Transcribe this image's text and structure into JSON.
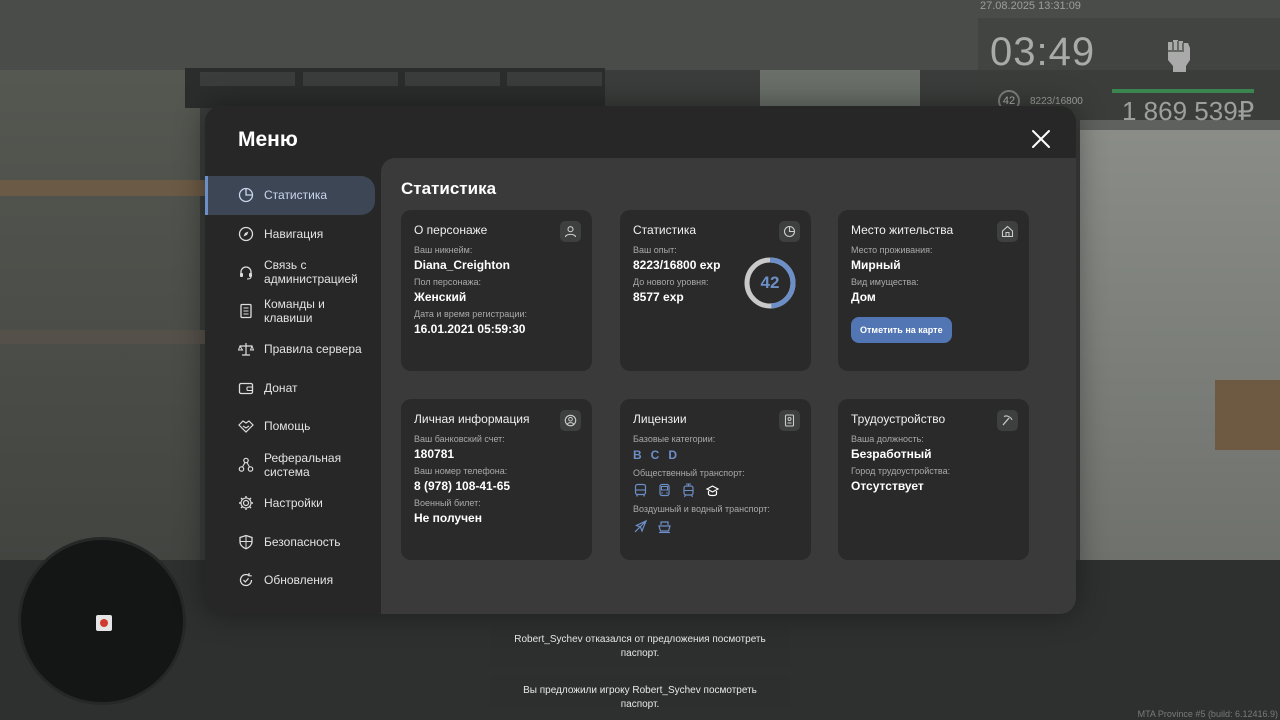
{
  "hud": {
    "datetime": "27.08.2025 13:31:09",
    "clock": "03:49",
    "level": "42",
    "exp": "8223/16800",
    "money": "1 869 539₽"
  },
  "notifications": [
    "Robert_Sychev отказался от предложения посмотреть паспорт.",
    "Вы предложили игроку Robert_Sychev посмотреть паспорт."
  ],
  "build_info": "MTA Province #5 (build: 6.12416.9)",
  "menu": {
    "title": "Меню",
    "sidebar": [
      {
        "label": "Статистика",
        "icon": "pie-chart-icon"
      },
      {
        "label": "Навигация",
        "icon": "compass-icon"
      },
      {
        "label": "Связь с администрацией",
        "icon": "headset-icon"
      },
      {
        "label": "Команды и клавиши",
        "icon": "document-icon"
      },
      {
        "label": "Правила сервера",
        "icon": "scales-icon"
      },
      {
        "label": "Донат",
        "icon": "wallet-icon"
      },
      {
        "label": "Помощь",
        "icon": "handshake-icon"
      },
      {
        "label": "Реферальная система",
        "icon": "network-icon"
      },
      {
        "label": "Настройки",
        "icon": "gear-icon"
      },
      {
        "label": "Безопасность",
        "icon": "shield-icon"
      },
      {
        "label": "Обновления",
        "icon": "refresh-check-icon"
      }
    ],
    "content_title": "Статистика",
    "cards": {
      "character": {
        "title": "О персонаже",
        "nickname_label": "Ваш никнейм:",
        "nickname": "Diana_Creighton",
        "gender_label": "Пол персонажа:",
        "gender": "Женский",
        "reg_label": "Дата и время регистрации:",
        "reg": "16.01.2021 05:59:30"
      },
      "stats": {
        "title": "Статистика",
        "exp_label": "Ваш опыт:",
        "exp": "8223/16800 exp",
        "next_label": "До нового уровня:",
        "next": "8577 exp",
        "level": "42",
        "level_progress": 0.49
      },
      "residence": {
        "title": "Место жительства",
        "place_label": "Место проживания:",
        "place": "Мирный",
        "type_label": "Вид имущества:",
        "type": "Дом",
        "button": "Отметить на карте"
      },
      "personal": {
        "title": "Личная информация",
        "bank_label": "Ваш банковский счет:",
        "bank": "180781",
        "phone_label": "Ваш номер телефона:",
        "phone": "8 (978) 108-41-65",
        "military_label": "Военный билет:",
        "military": "Не получен"
      },
      "licenses": {
        "title": "Лицензии",
        "base_label": "Базовые категории:",
        "categories": [
          "B",
          "C",
          "D"
        ],
        "public_label": "Общественный транспорт:",
        "public_icons": [
          "bus-icon",
          "bus-front-icon",
          "tram-icon",
          "taxi-icon"
        ],
        "air_label": "Воздушный и водный транспорт:",
        "air_icons": [
          "plane-icon",
          "boat-icon"
        ]
      },
      "job": {
        "title": "Трудоустройство",
        "position_label": "Ваша должность:",
        "position": "Безработный",
        "city_label": "Город трудоустройства:",
        "city": "Отсутствует"
      }
    }
  },
  "colors": {
    "accent": "#6d8fc7",
    "button": "#5276b3",
    "card": "#2a2a2a",
    "panel": "#3a3a3a",
    "window": "#262726"
  }
}
